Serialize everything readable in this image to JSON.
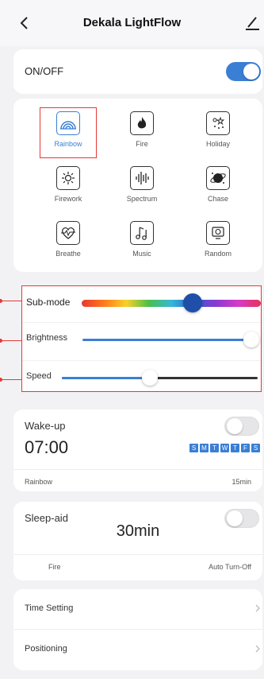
{
  "header": {
    "title": "Dekala LightFlow"
  },
  "power": {
    "label": "ON/OFF",
    "on": true
  },
  "modes": [
    {
      "label": "Rainbow",
      "icon": "rainbow-icon",
      "selected": true
    },
    {
      "label": "Fire",
      "icon": "fire-icon"
    },
    {
      "label": "Holiday",
      "icon": "holiday-icon"
    },
    {
      "label": "Firework",
      "icon": "firework-icon"
    },
    {
      "label": "Spectrum",
      "icon": "spectrum-icon"
    },
    {
      "label": "Chase",
      "icon": "chase-icon"
    },
    {
      "label": "Breathe",
      "icon": "breathe-icon"
    },
    {
      "label": "Music",
      "icon": "music-icon"
    },
    {
      "label": "Random",
      "icon": "random-icon"
    }
  ],
  "sliders": {
    "submode": {
      "label": "Sub-mode",
      "value": 0.62
    },
    "brightness": {
      "label": "Brightness",
      "value": 1.0
    },
    "speed": {
      "label": "Speed",
      "value": 0.45
    }
  },
  "wakeup": {
    "title": "Wake-up",
    "enabled": false,
    "time": "07:00",
    "days": [
      "S",
      "M",
      "T",
      "W",
      "T",
      "F",
      "S"
    ],
    "mode": "Rainbow",
    "duration": "15min"
  },
  "sleep": {
    "title": "Sleep-aid",
    "enabled": false,
    "time": "30min",
    "mode": "Fire",
    "action": "Auto Turn-Off"
  },
  "settings": {
    "time_setting": "Time Setting",
    "positioning": "Positioning"
  },
  "colors": {
    "accent": "#3a7fd4",
    "highlight": "#e53935",
    "thumb_dark": "#1f4fa8"
  }
}
